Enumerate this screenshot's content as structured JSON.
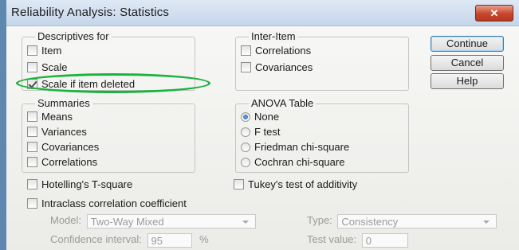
{
  "window": {
    "title": "Reliability Analysis: Statistics",
    "close_glyph": "✕",
    "close_icon": "close-icon"
  },
  "descriptives": {
    "legend": "Descriptives for",
    "items": [
      {
        "label": "Item",
        "checked": false
      },
      {
        "label": "Scale",
        "checked": false
      },
      {
        "label": "Scale if item deleted",
        "checked": true
      }
    ]
  },
  "inter_item": {
    "legend": "Inter-Item",
    "items": [
      {
        "label": "Correlations",
        "checked": false
      },
      {
        "label": "Covariances",
        "checked": false
      }
    ]
  },
  "summaries": {
    "legend": "Summaries",
    "items": [
      {
        "label": "Means",
        "checked": false
      },
      {
        "label": "Variances",
        "checked": false
      },
      {
        "label": "Covariances",
        "checked": false
      },
      {
        "label": "Correlations",
        "checked": false
      }
    ]
  },
  "anova": {
    "legend": "ANOVA Table",
    "options": [
      {
        "label": "None",
        "selected": true
      },
      {
        "label": "F test",
        "selected": false
      },
      {
        "label": "Friedman chi-square",
        "selected": false
      },
      {
        "label": "Cochran chi-square",
        "selected": false
      }
    ]
  },
  "buttons": {
    "continue": "Continue",
    "cancel": "Cancel",
    "help": "Help"
  },
  "hotelling": {
    "label": "Hotelling's T-square",
    "checked": false
  },
  "tukey": {
    "label": "Tukey's test of additivity",
    "checked": false
  },
  "intraclass": {
    "label": "Intraclass correlation coefficient",
    "checked": false
  },
  "model": {
    "label": "Model:",
    "value": "Two-Way Mixed"
  },
  "type": {
    "label": "Type:",
    "value": "Consistency"
  },
  "confidence": {
    "label": "Confidence interval:",
    "value": "95",
    "unit": "%"
  },
  "test_value": {
    "label": "Test value:",
    "value": "0"
  },
  "colors": {
    "highlight_ellipse": "#19b33c",
    "titlebar": "#c5d6ea",
    "close_button": "#c7452b"
  }
}
